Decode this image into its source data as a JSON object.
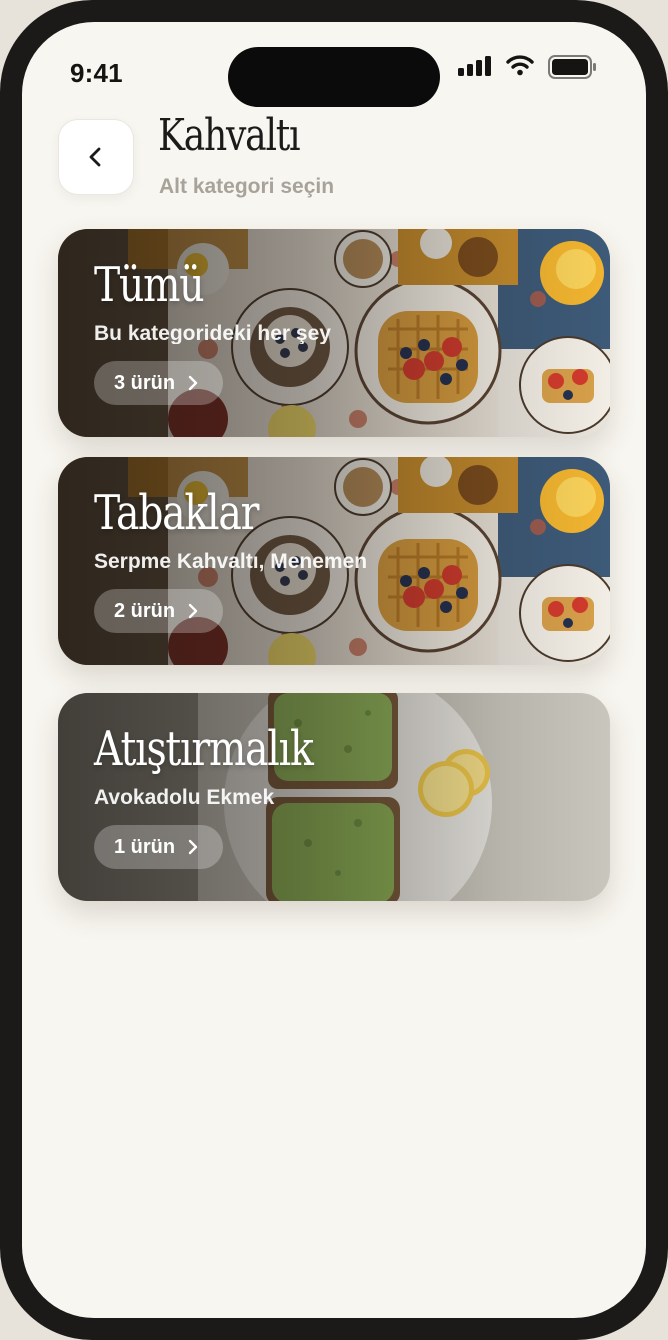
{
  "status_bar": {
    "time": "9:41"
  },
  "header": {
    "title": "Kahvaltı",
    "subtitle": "Alt kategori seçin"
  },
  "categories": [
    {
      "title": "Tümü",
      "description": "Bu kategorideki her şey",
      "count_label": "3 ürün",
      "image": "breakfast-spread-waffles"
    },
    {
      "title": "Tabaklar",
      "description": "Serpme Kahvaltı, Menemen",
      "count_label": "2 ürün",
      "image": "breakfast-spread-waffles"
    },
    {
      "title": "Atıştırmalık",
      "description": "Avokadolu Ekmek",
      "count_label": "1 ürün",
      "image": "avocado-toast-plate"
    }
  ],
  "icons": {
    "back": "chevron-left-icon",
    "card_arrow": "chevron-right-icon",
    "signal": "cellular-signal-icon",
    "wifi": "wifi-icon",
    "battery": "battery-icon"
  },
  "colors": {
    "background": "#f8f6f0",
    "title": "#1c1b19",
    "subtitle": "#a8a39a",
    "frame": "#1b1a18"
  }
}
